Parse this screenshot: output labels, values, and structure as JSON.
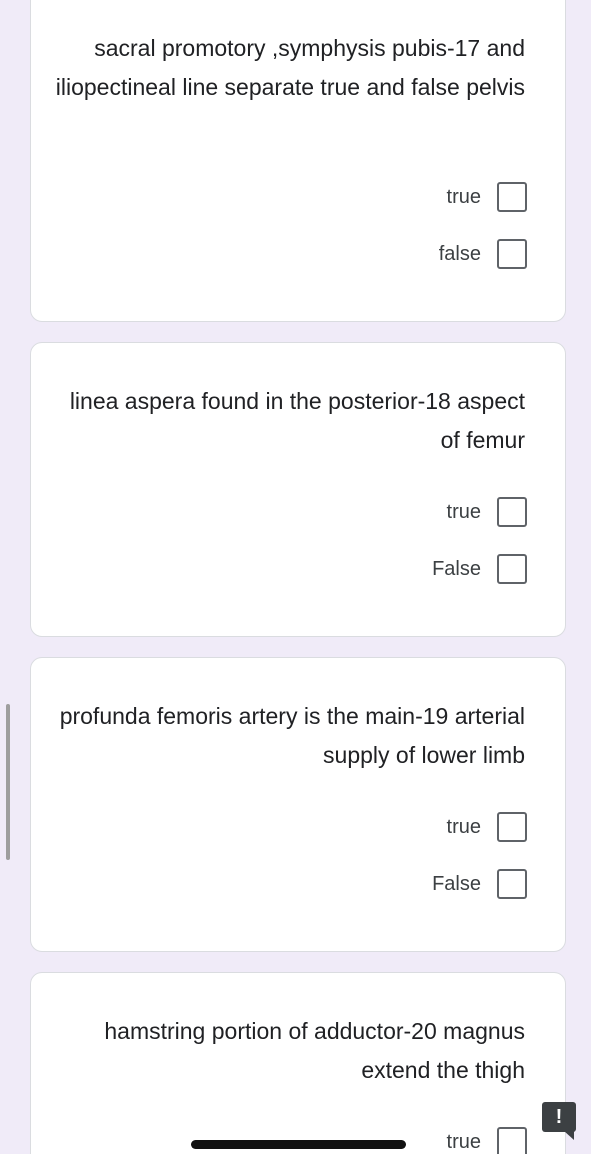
{
  "questions": [
    {
      "text": "sacral promotory ,symphysis pubis-17 and iliopectineal line separate true and false pelvis",
      "options": [
        {
          "label": "true",
          "checked": false
        },
        {
          "label": "false",
          "checked": false
        }
      ]
    },
    {
      "text": "linea aspera found in the posterior-18 aspect of femur",
      "options": [
        {
          "label": "true",
          "checked": false
        },
        {
          "label": "False",
          "checked": false
        }
      ]
    },
    {
      "text": "profunda femoris artery is the main-19 arterial supply of lower limb",
      "options": [
        {
          "label": "true",
          "checked": false
        },
        {
          "label": "False",
          "checked": false
        }
      ]
    },
    {
      "text": "hamstring portion of adductor-20 magnus extend the thigh",
      "options": [
        {
          "label": "true",
          "checked": false
        }
      ]
    }
  ],
  "feedback": {
    "icon": "feedback-exclamation-icon",
    "glyph": "!"
  },
  "colors": {
    "background": "#f0ebf8",
    "card": "#ffffff",
    "checkbox_border": "#5f6368"
  }
}
